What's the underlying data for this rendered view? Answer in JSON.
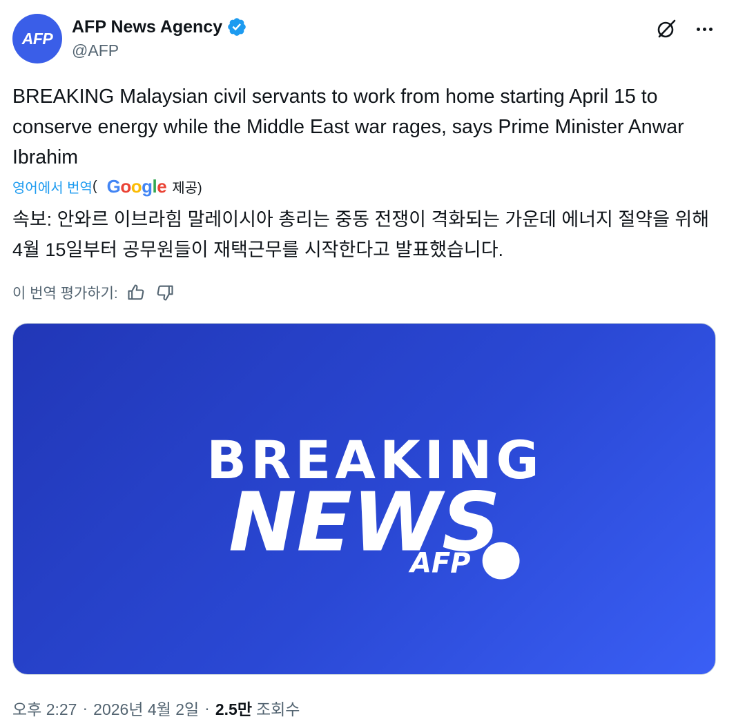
{
  "author": {
    "avatar_text": "AFP",
    "display_name": "AFP News Agency",
    "handle": "@AFP",
    "verified": true
  },
  "tweet": {
    "text": "BREAKING Malaysian civil servants to work from home starting April 15 to conserve energy while the Middle East war rages, says Prime Minister Anwar Ibrahim"
  },
  "translation": {
    "link_text": "영어에서 번역",
    "paren_open": "(",
    "google_logo": "Google",
    "provided_text": "제공)",
    "translated_text": "속보: 안와르 이브라힘 말레이시아 총리는 중동 전쟁이 격화되는 가운데 에너지 절약을 위해 4월 15일부터 공무원들이 재택근무를 시작한다고 발표했습니다.",
    "rate_label": "이 번역 평가하기:"
  },
  "media": {
    "line1": "BREAKING",
    "line2": "NEWS",
    "brand": "AFP"
  },
  "meta": {
    "time": "오후 2:27",
    "separator": "·",
    "date": "2026년 4월 2일",
    "views_count": "2.5만",
    "views_label": "조회수"
  },
  "icons": {
    "verified": "verified-badge-icon",
    "grok": "grok-icon",
    "more": "more-icon",
    "thumbs_up": "thumbs-up-icon",
    "thumbs_down": "thumbs-down-icon"
  },
  "colors": {
    "brand_blue": "#3a5ee8",
    "link": "#1d9bf0",
    "secondary_text": "#536471",
    "primary_text": "#0f1419"
  }
}
